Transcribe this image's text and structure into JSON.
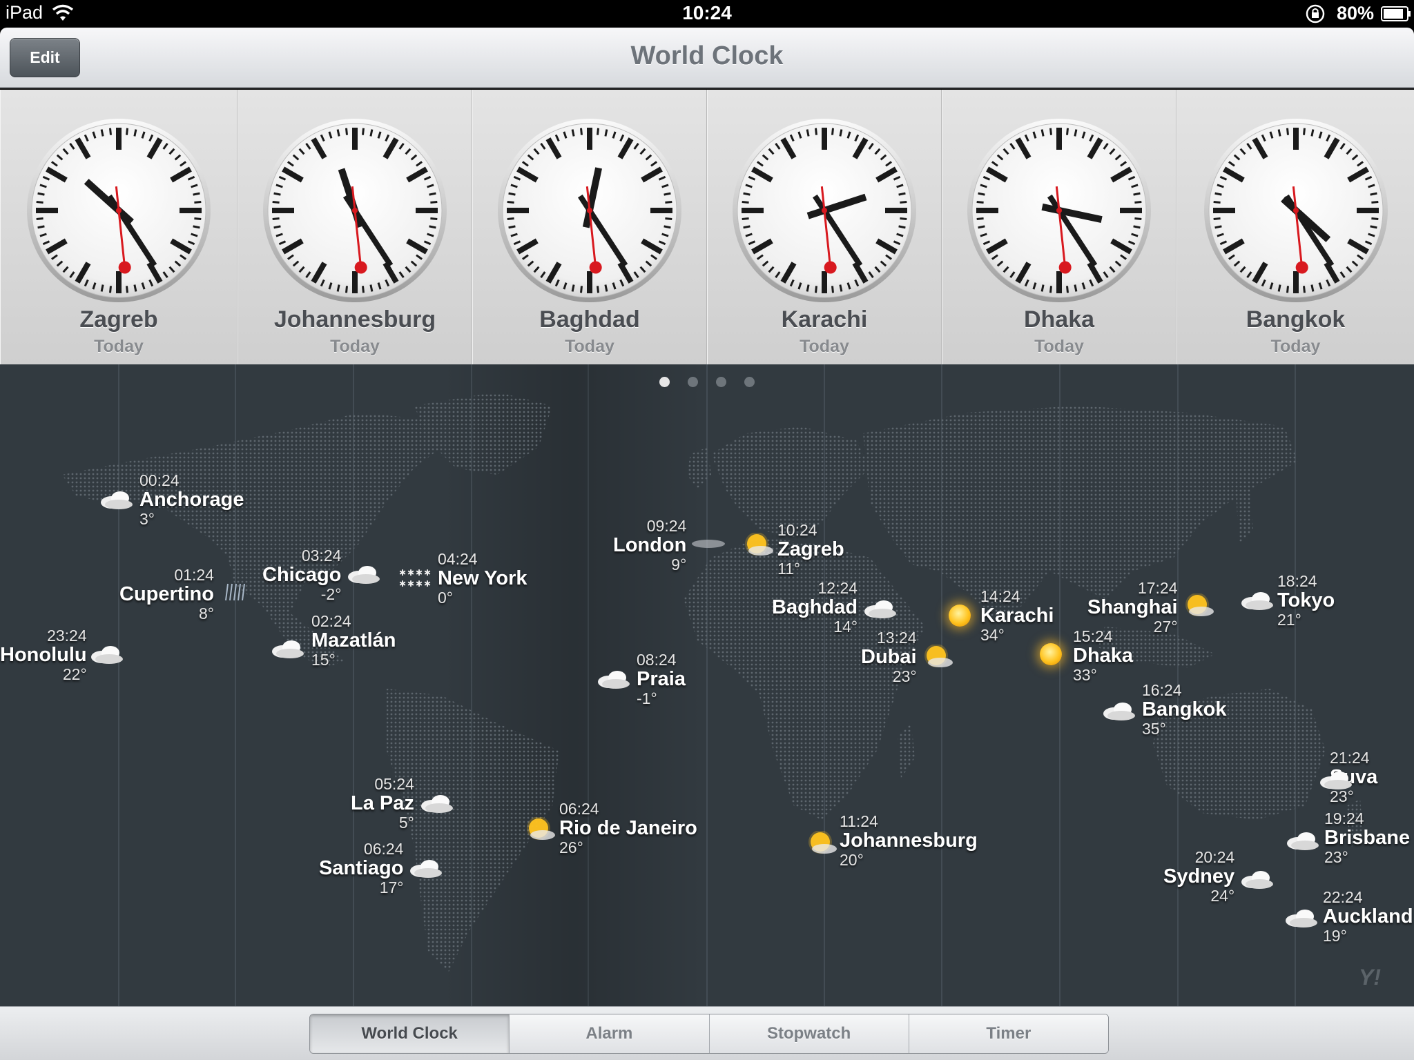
{
  "status_bar": {
    "carrier": "iPad",
    "time": "10:24",
    "battery": "80%"
  },
  "nav": {
    "edit_label": "Edit",
    "title": "World Clock"
  },
  "clocks": [
    {
      "city": "Zagreb",
      "day": "Today",
      "hour": 10,
      "minute": 24,
      "second": 29
    },
    {
      "city": "Johannesburg",
      "day": "Today",
      "hour": 11,
      "minute": 24,
      "second": 29
    },
    {
      "city": "Baghdad",
      "day": "Today",
      "hour": 12,
      "minute": 24,
      "second": 29
    },
    {
      "city": "Karachi",
      "day": "Today",
      "hour": 14,
      "minute": 24,
      "second": 29
    },
    {
      "city": "Dhaka",
      "day": "Today",
      "hour": 15,
      "minute": 24,
      "second": 29
    },
    {
      "city": "Bangkok",
      "day": "Today",
      "hour": 16,
      "minute": 24,
      "second": 29
    }
  ],
  "page_dots": {
    "count": 4,
    "active": 0
  },
  "map_cities": [
    {
      "time": "00:24",
      "name": "Anchorage",
      "temp": "3°",
      "weather": "cloud-icon"
    },
    {
      "time": "01:24",
      "name": "Cupertino",
      "temp": "8°",
      "weather": "rain-icon"
    },
    {
      "time": "23:24",
      "name": "Honolulu",
      "temp": "22°",
      "weather": "cloud-icon"
    },
    {
      "time": "03:24",
      "name": "Chicago",
      "temp": "-2°",
      "weather": "cloud-icon"
    },
    {
      "time": "04:24",
      "name": "New York",
      "temp": "0°",
      "weather": "snow-icon"
    },
    {
      "time": "02:24",
      "name": "Mazatlán",
      "temp": "15°",
      "weather": "cloud-icon"
    },
    {
      "time": "09:24",
      "name": "London",
      "temp": "9°",
      "weather": "fog-icon"
    },
    {
      "time": "10:24",
      "name": "Zagreb",
      "temp": "11°",
      "weather": "partly-sunny-icon"
    },
    {
      "time": "12:24",
      "name": "Baghdad",
      "temp": "14°",
      "weather": "cloud-icon"
    },
    {
      "time": "14:24",
      "name": "Karachi",
      "temp": "34°",
      "weather": "sun-icon"
    },
    {
      "time": "13:24",
      "name": "Dubai",
      "temp": "23°",
      "weather": "partly-sunny-icon"
    },
    {
      "time": "15:24",
      "name": "Dhaka",
      "temp": "33°",
      "weather": "sun-icon"
    },
    {
      "time": "17:24",
      "name": "Shanghai",
      "temp": "27°",
      "weather": "partly-sunny-icon"
    },
    {
      "time": "18:24",
      "name": "Tokyo",
      "temp": "21°",
      "weather": "cloud-icon"
    },
    {
      "time": "08:24",
      "name": "Praia",
      "temp": "-1°",
      "weather": "cloud-icon"
    },
    {
      "time": "16:24",
      "name": "Bangkok",
      "temp": "35°",
      "weather": "cloud-icon"
    },
    {
      "time": "05:24",
      "name": "La Paz",
      "temp": "5°",
      "weather": "cloud-icon"
    },
    {
      "time": "06:24",
      "name": "Rio de Janeiro",
      "temp": "26°",
      "weather": "partly-sunny-icon"
    },
    {
      "time": "06:24",
      "name": "Santiago",
      "temp": "17°",
      "weather": "cloud-icon"
    },
    {
      "time": "11:24",
      "name": "Johannesburg",
      "temp": "20°",
      "weather": "partly-sunny-icon"
    },
    {
      "time": "21:24",
      "name": "Suva",
      "temp": "23°",
      "weather": "cloud-icon"
    },
    {
      "time": "19:24",
      "name": "Brisbane",
      "temp": "23°",
      "weather": "cloud-icon"
    },
    {
      "time": "20:24",
      "name": "Sydney",
      "temp": "24°",
      "weather": "cloud-icon"
    },
    {
      "time": "22:24",
      "name": "Auckland",
      "temp": "19°",
      "weather": "cloud-icon"
    }
  ],
  "provider_logo": "Y!",
  "tabs": [
    {
      "label": "World Clock",
      "active": true
    },
    {
      "label": "Alarm",
      "active": false
    },
    {
      "label": "Stopwatch",
      "active": false
    },
    {
      "label": "Timer",
      "active": false
    }
  ],
  "colors": {
    "second_hand": "#d8191f",
    "map_bg": "#323a40",
    "sun": "#ffc31f"
  }
}
